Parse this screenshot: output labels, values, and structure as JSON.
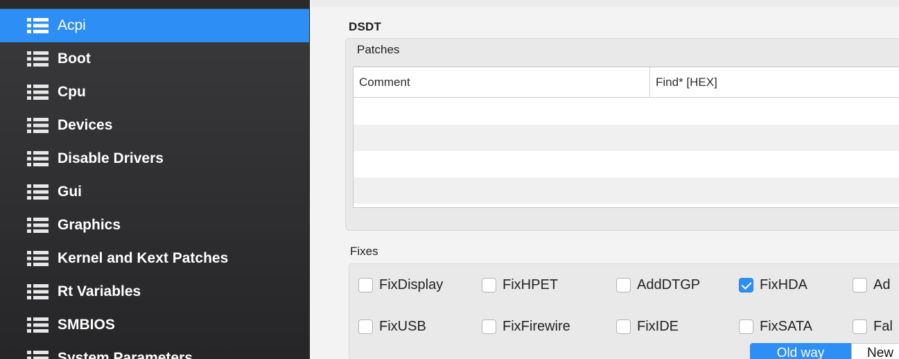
{
  "sidebar": {
    "items": [
      {
        "label": "Acpi",
        "selected": true
      },
      {
        "label": "Boot"
      },
      {
        "label": "Cpu"
      },
      {
        "label": "Devices"
      },
      {
        "label": "Disable Drivers"
      },
      {
        "label": "Gui"
      },
      {
        "label": "Graphics"
      },
      {
        "label": "Kernel and Kext Patches"
      },
      {
        "label": "Rt Variables"
      },
      {
        "label": "SMBIOS"
      },
      {
        "label": "System Parameters"
      }
    ],
    "icon": "list-icon",
    "selected_color": "#2d8ef5"
  },
  "dsdt": {
    "title": "DSDT",
    "patches": {
      "title": "Patches",
      "columns": [
        "Comment",
        "Find* [HEX]"
      ]
    },
    "fixes": {
      "title": "Fixes",
      "checkboxes": [
        {
          "label": "FixDisplay",
          "checked": false
        },
        {
          "label": "FixHPET",
          "checked": false
        },
        {
          "label": "AddDTGP",
          "checked": false
        },
        {
          "label": "FixHDA",
          "checked": true
        },
        {
          "label": "Ad",
          "checked": false
        },
        {
          "label": "FixUSB",
          "checked": false
        },
        {
          "label": "FixFirewire",
          "checked": false
        },
        {
          "label": "FixIDE",
          "checked": false
        },
        {
          "label": "FixSATA",
          "checked": false
        },
        {
          "label": "Fal",
          "checked": false
        }
      ]
    },
    "mode": {
      "options": [
        "Old way",
        "New"
      ],
      "selected": "Old way"
    }
  }
}
